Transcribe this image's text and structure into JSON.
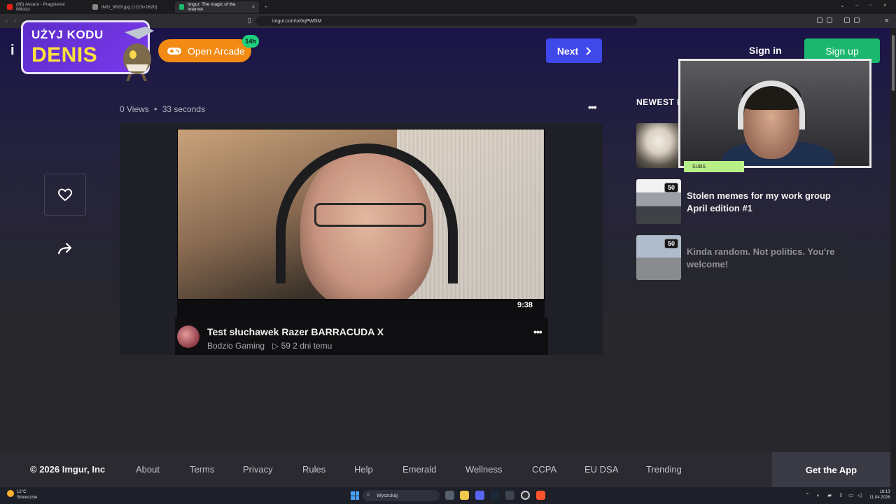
{
  "browser": {
    "tabs": [
      {
        "title": "(88) Akcent - Pragnienie Miłości",
        "active": false
      },
      {
        "title": "IMG_9629.jpg (1215×1620)",
        "active": false
      },
      {
        "title": "Imgur: The magic of the Internet",
        "active": true
      }
    ],
    "new_tab": "+",
    "url": "imgur.com/a/0qPW6iM"
  },
  "promo": {
    "line1": "UŻYJ KODU",
    "line2": "DENIS"
  },
  "header": {
    "arcade_label": "Open Arcade",
    "arcade_badge": "14h",
    "next_label": "Next",
    "signin_label": "Sign in",
    "signup_label": "Sign up"
  },
  "post": {
    "meta_views": "0 Views",
    "meta_sep": "•",
    "meta_time": "33 seconds",
    "more": "•••"
  },
  "video": {
    "duration": "9:38",
    "title": "Test słuchawek Razer BARRACUDA X",
    "channel": "Bodzio Gaming",
    "views": "▷ 59  2 dni temu",
    "more": "•••"
  },
  "sidebar": {
    "heading": "NEWEST I",
    "items": [
      {
        "title": "",
        "badge": ""
      },
      {
        "title": "Stolen memes for my work group April edition #1",
        "badge": "50"
      },
      {
        "title": "Kinda random. Not politics. You're welcome!",
        "badge": "50"
      }
    ]
  },
  "overlay": {
    "subs_label": "SUBS"
  },
  "footer": {
    "copyright": "© 2026 Imgur, Inc",
    "links": [
      "About",
      "Terms",
      "Privacy",
      "Rules",
      "Help",
      "Emerald",
      "Wellness",
      "CCPA",
      "EU DSA",
      "Trending"
    ],
    "get_app": "Get the App"
  },
  "taskbar": {
    "temp": "12°C",
    "weather": "Słonecznie",
    "search_placeholder": "Wyszukaj",
    "time": "18:13",
    "date": "11.04.2026"
  },
  "colors": {
    "next": "#3f48e8",
    "signup": "#1bb76e",
    "arcade": "#f28a14",
    "badge": "#1ed07d"
  }
}
